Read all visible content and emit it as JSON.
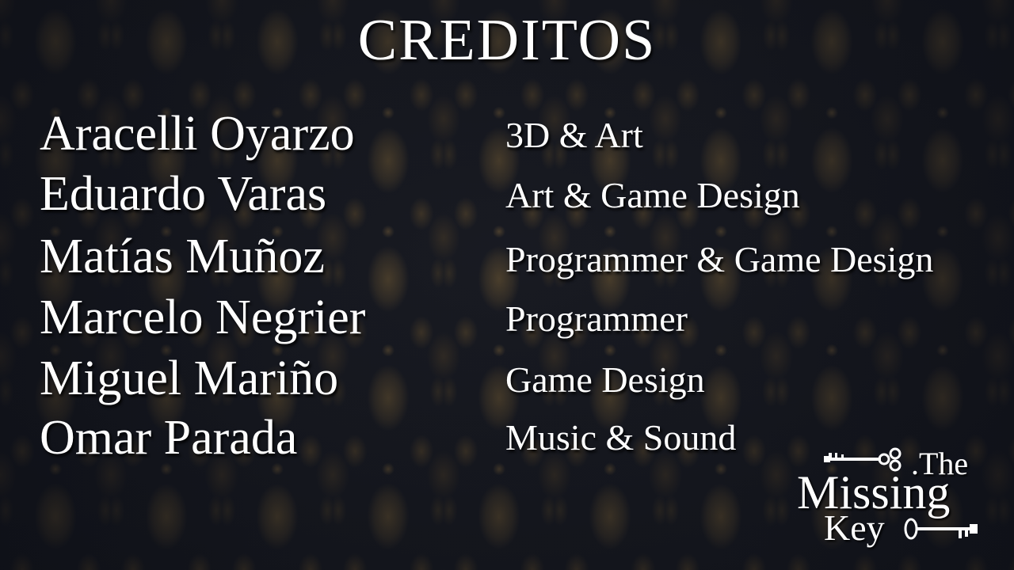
{
  "screen": {
    "title": "CREDITOS"
  },
  "credits": [
    {
      "name": "Aracelli Oyarzo",
      "role": "3D & Art"
    },
    {
      "name": "Eduardo Varas",
      "role": "Art & Game Design"
    },
    {
      "name": "Matías Muñoz",
      "role": "Programmer & Game Design"
    },
    {
      "name": "Marcelo Negrier",
      "role": "Programmer"
    },
    {
      "name": "Miguel Mariño",
      "role": "Game Design"
    },
    {
      "name": "Omar Parada",
      "role": "Music & Sound"
    }
  ],
  "logo": {
    "the": ".The",
    "missing": "Missing",
    "key": "Key",
    "icons": [
      "key-icon",
      "key-icon"
    ]
  },
  "colors": {
    "text": "#ffffff",
    "background": "#1b1d24",
    "damask_gold": "#96763e"
  }
}
